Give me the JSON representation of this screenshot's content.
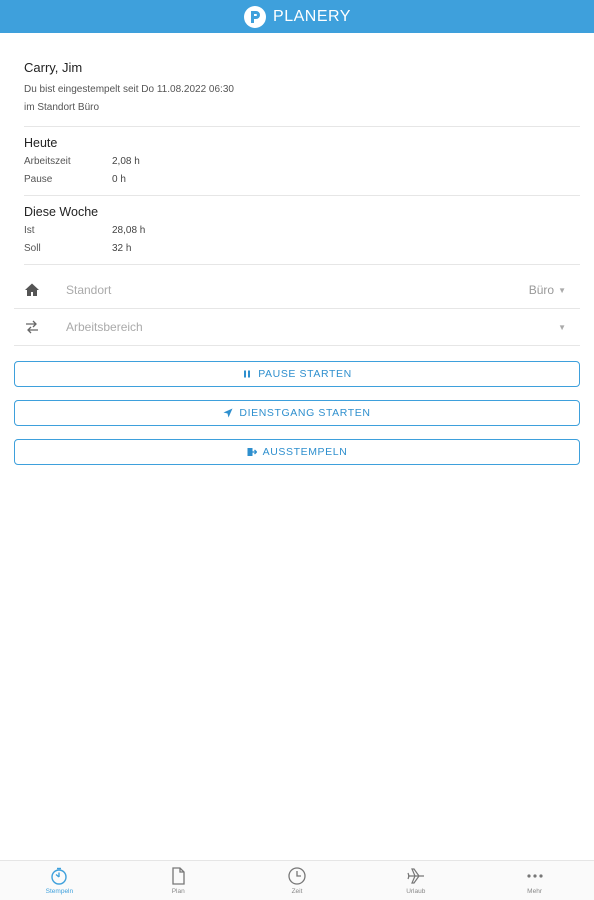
{
  "header": {
    "brand": "PLANERY"
  },
  "user": {
    "name": "Carry, Jim",
    "status_line": "Du bist eingestempelt seit Do 11.08.2022 06:30",
    "location_line": "im Standort Büro"
  },
  "today": {
    "title": "Heute",
    "rows": [
      {
        "label": "Arbeitszeit",
        "value": "2,08 h"
      },
      {
        "label": "Pause",
        "value": "0 h"
      }
    ]
  },
  "week": {
    "title": "Diese Woche",
    "rows": [
      {
        "label": "Ist",
        "value": "28,08 h"
      },
      {
        "label": "Soll",
        "value": "32 h"
      }
    ]
  },
  "fields": {
    "location": {
      "label": "Standort",
      "value": "Büro",
      "icon": "home-icon"
    },
    "area": {
      "label": "Arbeitsbereich",
      "value": "",
      "icon": "swap-arrows-icon"
    }
  },
  "actions": {
    "pause": "PAUSE STARTEN",
    "business_trip": "DIENSTGANG STARTEN",
    "clock_out": "AUSSTEMPELN"
  },
  "tabs": [
    {
      "label": "Stempeln",
      "icon": "stopwatch-icon",
      "active": true
    },
    {
      "label": "Plan",
      "icon": "document-icon",
      "active": false
    },
    {
      "label": "Zeit",
      "icon": "clock-icon",
      "active": false
    },
    {
      "label": "Urlaub",
      "icon": "airplane-icon",
      "active": false
    },
    {
      "label": "Mehr",
      "icon": "more-dots-icon",
      "active": false
    }
  ],
  "colors": {
    "accent": "#3ea0dc",
    "divider": "#e6e6e6"
  }
}
